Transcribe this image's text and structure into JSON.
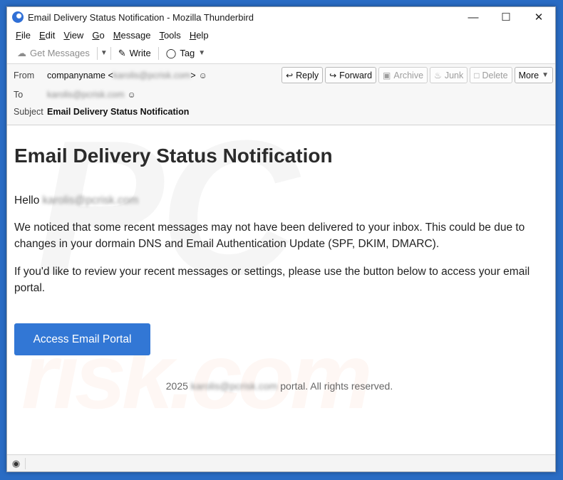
{
  "window": {
    "title": "Email Delivery Status Notification - Mozilla Thunderbird"
  },
  "menubar": {
    "items": [
      {
        "label_ul": "F",
        "label_rest": "ile"
      },
      {
        "label_ul": "E",
        "label_rest": "dit"
      },
      {
        "label_ul": "V",
        "label_rest": "iew"
      },
      {
        "label_ul": "G",
        "label_rest": "o"
      },
      {
        "label_ul": "M",
        "label_rest": "essage"
      },
      {
        "label_ul": "T",
        "label_rest": "ools"
      },
      {
        "label_ul": "H",
        "label_rest": "elp"
      }
    ]
  },
  "toolbar": {
    "get_messages": "Get Messages",
    "write": "Write",
    "tag": "Tag"
  },
  "header": {
    "from_label": "From",
    "from_name": "companyname <",
    "from_email": "karolis@pcrisk.com",
    "from_close": ">",
    "to_label": "To",
    "to_email": "karolis@pcrisk.com",
    "subject_label": "Subject",
    "subject": "Email Delivery Status Notification"
  },
  "actions": {
    "reply": "Reply",
    "forward": "Forward",
    "archive": "Archive",
    "junk": "Junk",
    "delete": "Delete",
    "more": "More"
  },
  "email": {
    "title": "Email Delivery Status Notification",
    "greeting": "Hello",
    "greeting_email": "karolis@pcrisk.com",
    "paragraph1": "We noticed that some recent messages may not have been delivered to your inbox. This could be due to changes in your dormain DNS and Email Authentication Update (SPF, DKIM, DMARC).",
    "paragraph2": "If you'd like to review your recent messages or settings, please use the button below to access your email portal.",
    "button": "Access Email Portal",
    "footer_year": "2025",
    "footer_email": "karolis@pcrisk.com",
    "footer_rest": " portal. All rights reserved."
  },
  "watermark": {
    "line1": "PC",
    "line2": "risk.com"
  },
  "colors": {
    "accent": "#3277d5",
    "desktop": "#2a6cc4"
  }
}
